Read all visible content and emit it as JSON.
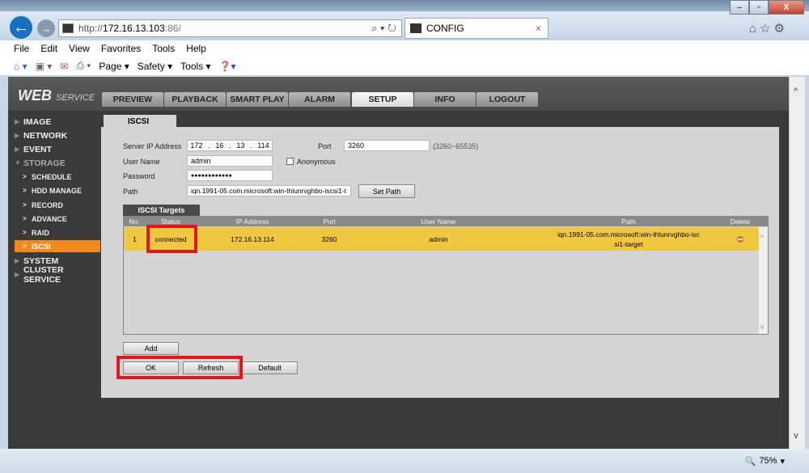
{
  "browser": {
    "url_prefix": "http://",
    "url_host": "172.16.13.103",
    "url_rest": ":86/",
    "tab_title": "CONFIG",
    "zoom": "75%",
    "menu": [
      "File",
      "Edit",
      "View",
      "Favorites",
      "Tools",
      "Help"
    ],
    "cmd": [
      "Page ▾",
      "Safety ▾",
      "Tools ▾"
    ]
  },
  "app": {
    "logo_main": "WEB",
    "logo_sub": "SERVICE",
    "nav": [
      "PREVIEW",
      "PLAYBACK",
      "SMART PLAY",
      "ALARM",
      "SETUP",
      "INFO",
      "LOGOUT"
    ],
    "active_nav": "SETUP",
    "sidebar": [
      {
        "label": "IMAGE"
      },
      {
        "label": "NETWORK"
      },
      {
        "label": "EVENT"
      },
      {
        "label": "STORAGE"
      },
      {
        "label": "SCHEDULE"
      },
      {
        "label": "HDD MANAGE"
      },
      {
        "label": "RECORD"
      },
      {
        "label": "ADVANCE"
      },
      {
        "label": "RAID"
      },
      {
        "label": "ISCSI"
      },
      {
        "label": "SYSTEM"
      },
      {
        "label": "CLUSTER SERVICE"
      }
    ],
    "active_sidebar": "ISCSI"
  },
  "form": {
    "tab": "ISCSI",
    "server_ip_label": "Server IP Address",
    "ip": [
      "172",
      "16",
      "13",
      "114"
    ],
    "port_label": "Port",
    "port": "3260",
    "port_range": "(3260~65535)",
    "user_label": "User Name",
    "user": "admin",
    "anonymous_label": "Anonymous",
    "anonymous_checked": false,
    "password_label": "Password",
    "password": "●●●●●●●●●●●●",
    "path_label": "Path",
    "path": "iqn.1991-05.com.microsoft:win-thlunrvghbo-iscsi1-t",
    "set_path": "Set Path"
  },
  "targets": {
    "tab": "ISCSI Targets",
    "columns": [
      "No.",
      "Status",
      "IP Address",
      "Port",
      "User Name",
      "Path",
      "Delete"
    ],
    "rows": [
      {
        "no": "1",
        "status": "connected",
        "ip": "172.16.13.114",
        "port": "3260",
        "user": "admin",
        "path_l1": "iqn.1991-05.com.microsoft:win-thlunrvghbo-isc",
        "path_l2": "si1-target"
      }
    ]
  },
  "buttons": {
    "add": "Add",
    "ok": "OK",
    "refresh": "Refresh",
    "default": "Default"
  },
  "colors": {
    "highlight": "#f08a1e",
    "row_selected": "#f0c840",
    "annotation": "#e01818"
  }
}
